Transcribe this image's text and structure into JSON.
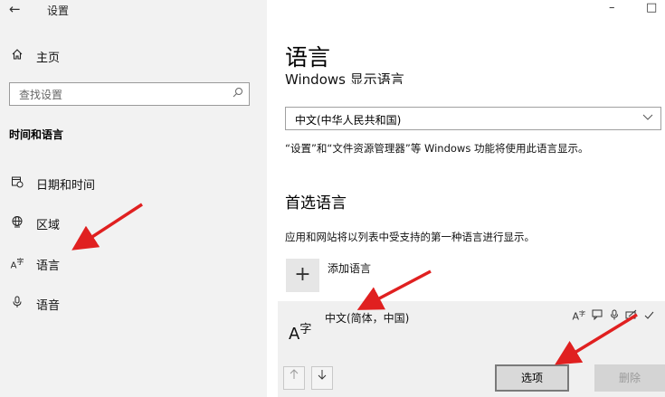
{
  "window": {
    "app_title": "设置",
    "back_glyph": "←",
    "minimize_glyph": "–",
    "maximize_glyph": "□"
  },
  "sidebar": {
    "home_label": "主页",
    "search_placeholder": "查找设置",
    "section_title": "时间和语言",
    "items": [
      {
        "icon": "calendar-clock-icon",
        "glyph": "🗓",
        "label": "日期和时间"
      },
      {
        "icon": "region-globe-icon",
        "glyph": "🌐",
        "label": "区域"
      },
      {
        "icon": "language-icon",
        "glyph": "A字",
        "label": "语言"
      },
      {
        "icon": "microphone-icon",
        "glyph": "🎙",
        "label": "语音"
      }
    ]
  },
  "main": {
    "page_title": "语言",
    "display_language_heading": "Windows 显示语言",
    "display_language_value": "中文(中华人民共和国)",
    "display_language_desc": "“设置”和“文件资源管理器”等 Windows 功能将使用此语言显示。",
    "preferred_title": "首选语言",
    "preferred_desc": "应用和网站将以列表中受支持的第一种语言进行显示。",
    "add_language_label": "添加语言",
    "language_item": {
      "name": "中文(简体，中国)",
      "feature_icons": [
        "display-language-icon",
        "speech-icon",
        "microphone-icon",
        "handwriting-icon",
        "spellcheck-icon"
      ]
    },
    "options_label": "选项",
    "remove_label": "删除"
  },
  "annotations": {
    "arrow_color": "#e02020"
  }
}
